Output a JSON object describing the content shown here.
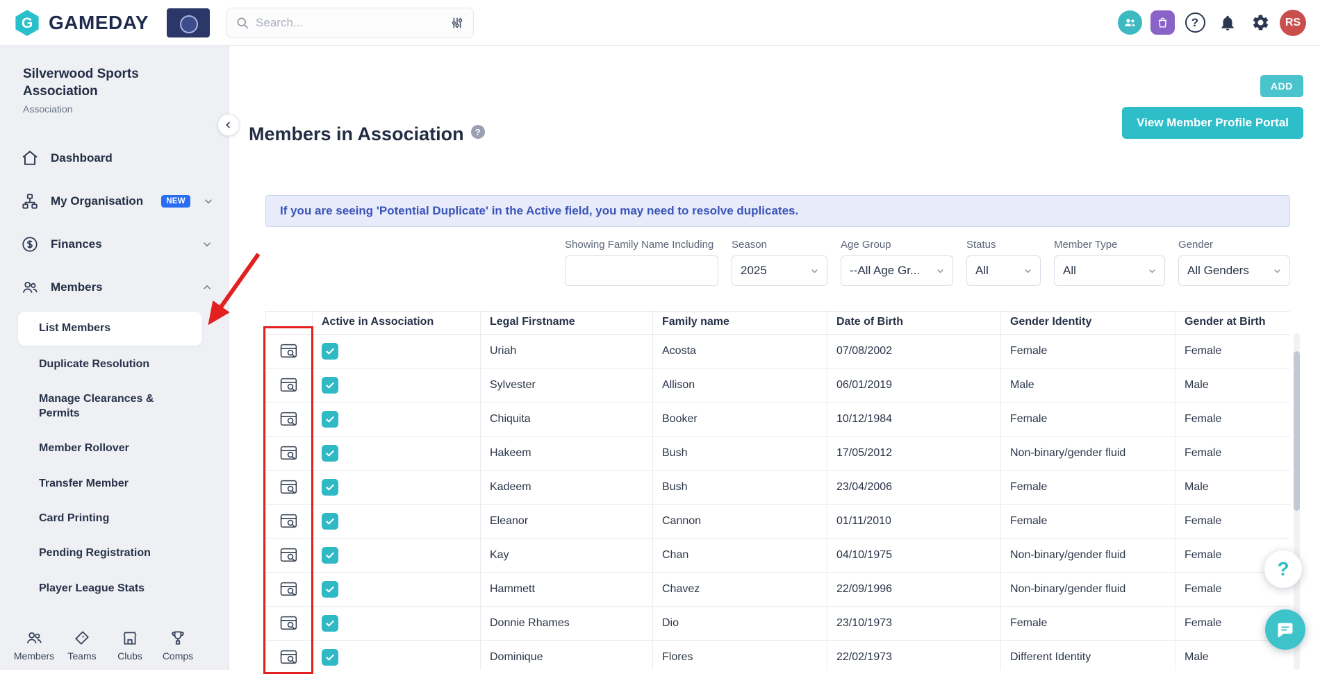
{
  "topbar": {
    "brand": "GAMEDAY",
    "search": {
      "placeholder": "Search..."
    },
    "avatar": "RS",
    "help_glyph": "?"
  },
  "sidebar": {
    "org_name": "Silverwood Sports Association",
    "org_type": "Association",
    "items": [
      {
        "label": "Dashboard"
      },
      {
        "label": "My Organisation",
        "badge": "NEW"
      },
      {
        "label": "Finances"
      },
      {
        "label": "Members"
      }
    ],
    "members_submenu": [
      {
        "label": "List Members",
        "active": true
      },
      {
        "label": "Duplicate Resolution"
      },
      {
        "label": "Manage Clearances & Permits"
      },
      {
        "label": "Member Rollover"
      },
      {
        "label": "Transfer Member"
      },
      {
        "label": "Card Printing"
      },
      {
        "label": "Pending Registration"
      },
      {
        "label": "Player League Stats"
      }
    ],
    "bottom_nav": [
      {
        "label": "Members"
      },
      {
        "label": "Teams"
      },
      {
        "label": "Clubs"
      },
      {
        "label": "Comps"
      }
    ]
  },
  "main": {
    "add_button": "ADD",
    "title": "Members in Association",
    "title_help": "?",
    "portal_button": "View Member Profile Portal",
    "notice": "If you are seeing 'Potential Duplicate' in the Active field, you may need to resolve duplicates.",
    "filters": [
      {
        "label": "Showing Family Name Including",
        "type": "input",
        "value": ""
      },
      {
        "label": "Season",
        "type": "select",
        "value": "2025"
      },
      {
        "label": "Age Group",
        "type": "select",
        "value": "--All Age Gr..."
      },
      {
        "label": "Status",
        "type": "select",
        "value": "All"
      },
      {
        "label": "Member Type",
        "type": "select",
        "value": "All"
      },
      {
        "label": "Gender",
        "type": "select",
        "value": "All Genders"
      }
    ],
    "table": {
      "columns": [
        "",
        "Active in Association",
        "Legal Firstname",
        "Family name",
        "Date of Birth",
        "Gender Identity",
        "Gender at Birth"
      ],
      "rows": [
        {
          "active": true,
          "first": "Uriah",
          "family": "Acosta",
          "dob": "07/08/2002",
          "gender_identity": "Female",
          "gender_birth": "Female"
        },
        {
          "active": true,
          "first": "Sylvester",
          "family": "Allison",
          "dob": "06/01/2019",
          "gender_identity": "Male",
          "gender_birth": "Male"
        },
        {
          "active": true,
          "first": "Chiquita",
          "family": "Booker",
          "dob": "10/12/1984",
          "gender_identity": "Female",
          "gender_birth": "Female"
        },
        {
          "active": true,
          "first": "Hakeem",
          "family": "Bush",
          "dob": "17/05/2012",
          "gender_identity": "Non-binary/gender fluid",
          "gender_birth": "Female"
        },
        {
          "active": true,
          "first": "Kadeem",
          "family": "Bush",
          "dob": "23/04/2006",
          "gender_identity": "Female",
          "gender_birth": "Male"
        },
        {
          "active": true,
          "first": "Eleanor",
          "family": "Cannon",
          "dob": "01/11/2010",
          "gender_identity": "Female",
          "gender_birth": "Female"
        },
        {
          "active": true,
          "first": "Kay",
          "family": "Chan",
          "dob": "04/10/1975",
          "gender_identity": "Non-binary/gender fluid",
          "gender_birth": "Female"
        },
        {
          "active": true,
          "first": "Hammett",
          "family": "Chavez",
          "dob": "22/09/1996",
          "gender_identity": "Non-binary/gender fluid",
          "gender_birth": "Female"
        },
        {
          "active": true,
          "first": "Donnie Rhames",
          "family": "Dio",
          "dob": "23/10/1973",
          "gender_identity": "Female",
          "gender_birth": "Female"
        },
        {
          "active": true,
          "first": "Dominique",
          "family": "Flores",
          "dob": "22/02/1973",
          "gender_identity": "Different Identity",
          "gender_birth": "Male"
        }
      ]
    }
  },
  "floating": {
    "help": "?"
  },
  "colors": {
    "brand_teal": "#2EBEC9",
    "navy": "#222C43",
    "sidebar_bg": "#EEF0F4",
    "checkbox_teal": "#2FB9C4",
    "badge_blue": "#2A6DF5",
    "notice_blue": "#3A54B8",
    "annotation_red": "#E32020",
    "avatar_red": "#C94F4D"
  }
}
